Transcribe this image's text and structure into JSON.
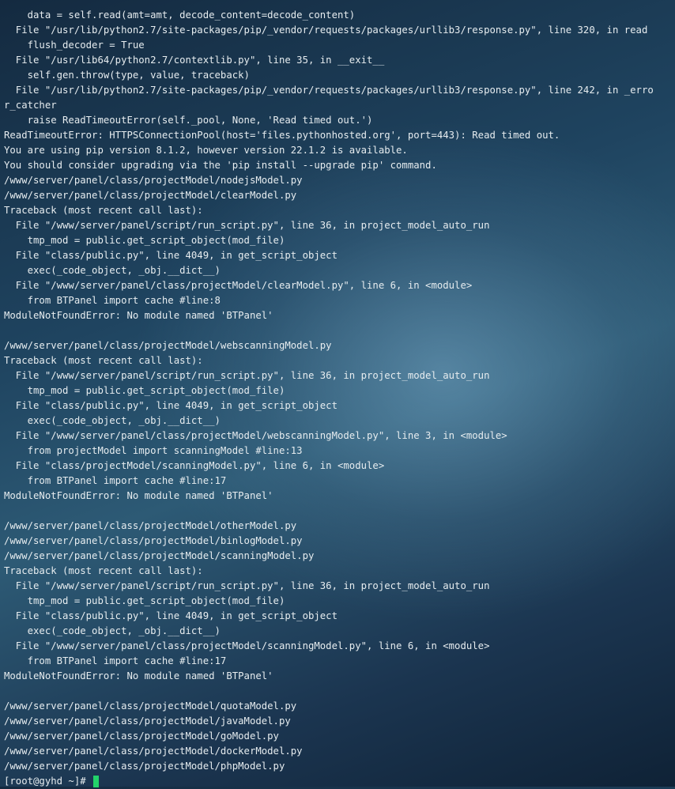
{
  "terminal": {
    "lines": [
      "\"",
      "    data = self.read(amt=amt, decode_content=decode_content)",
      "  File \"/usr/lib/python2.7/site-packages/pip/_vendor/requests/packages/urllib3/response.py\", line 320, in read",
      "    flush_decoder = True",
      "  File \"/usr/lib64/python2.7/contextlib.py\", line 35, in __exit__",
      "    self.gen.throw(type, value, traceback)",
      "  File \"/usr/lib/python2.7/site-packages/pip/_vendor/requests/packages/urllib3/response.py\", line 242, in _erro",
      "r_catcher",
      "    raise ReadTimeoutError(self._pool, None, 'Read timed out.')",
      "ReadTimeoutError: HTTPSConnectionPool(host='files.pythonhosted.org', port=443): Read timed out.",
      "You are using pip version 8.1.2, however version 22.1.2 is available.",
      "You should consider upgrading via the 'pip install --upgrade pip' command.",
      "/www/server/panel/class/projectModel/nodejsModel.py",
      "/www/server/panel/class/projectModel/clearModel.py",
      "Traceback (most recent call last):",
      "  File \"/www/server/panel/script/run_script.py\", line 36, in project_model_auto_run",
      "    tmp_mod = public.get_script_object(mod_file)",
      "  File \"class/public.py\", line 4049, in get_script_object",
      "    exec(_code_object, _obj.__dict__)",
      "  File \"/www/server/panel/class/projectModel/clearModel.py\", line 6, in <module>",
      "    from BTPanel import cache #line:8",
      "ModuleNotFoundError: No module named 'BTPanel'",
      "",
      "/www/server/panel/class/projectModel/webscanningModel.py",
      "Traceback (most recent call last):",
      "  File \"/www/server/panel/script/run_script.py\", line 36, in project_model_auto_run",
      "    tmp_mod = public.get_script_object(mod_file)",
      "  File \"class/public.py\", line 4049, in get_script_object",
      "    exec(_code_object, _obj.__dict__)",
      "  File \"/www/server/panel/class/projectModel/webscanningModel.py\", line 3, in <module>",
      "    from projectModel import scanningModel #line:13",
      "  File \"class/projectModel/scanningModel.py\", line 6, in <module>",
      "    from BTPanel import cache #line:17",
      "ModuleNotFoundError: No module named 'BTPanel'",
      "",
      "/www/server/panel/class/projectModel/otherModel.py",
      "/www/server/panel/class/projectModel/binlogModel.py",
      "/www/server/panel/class/projectModel/scanningModel.py",
      "Traceback (most recent call last):",
      "  File \"/www/server/panel/script/run_script.py\", line 36, in project_model_auto_run",
      "    tmp_mod = public.get_script_object(mod_file)",
      "  File \"class/public.py\", line 4049, in get_script_object",
      "    exec(_code_object, _obj.__dict__)",
      "  File \"/www/server/panel/class/projectModel/scanningModel.py\", line 6, in <module>",
      "    from BTPanel import cache #line:17",
      "ModuleNotFoundError: No module named 'BTPanel'",
      "",
      "/www/server/panel/class/projectModel/quotaModel.py",
      "/www/server/panel/class/projectModel/javaModel.py",
      "/www/server/panel/class/projectModel/goModel.py",
      "/www/server/panel/class/projectModel/dockerModel.py",
      "/www/server/panel/class/projectModel/phpModel.py"
    ],
    "prompt": "[root@gyhd ~]# ",
    "colors": {
      "text": "#e6ecef",
      "cursor": "#22d46a"
    }
  }
}
